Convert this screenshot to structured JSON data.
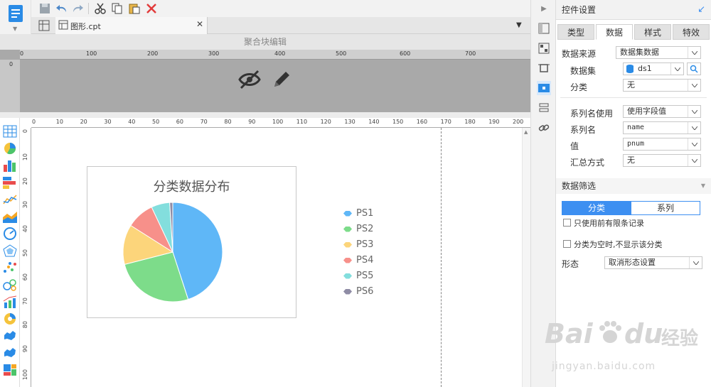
{
  "toolbar": {
    "file_tab": "图形.cpt"
  },
  "section_title": "聚合块编辑",
  "ruler": {
    "gray_top": [
      "0",
      "100",
      "200",
      "300",
      "400",
      "500",
      "600",
      "700"
    ],
    "top": [
      "0",
      "10",
      "20",
      "30",
      "40",
      "50",
      "60",
      "70",
      "80",
      "90",
      "100",
      "110",
      "120",
      "130",
      "140",
      "150",
      "160",
      "170",
      "180",
      "190",
      "200"
    ],
    "left": [
      "0",
      "10",
      "20",
      "30",
      "40",
      "50",
      "60",
      "70",
      "80",
      "90",
      "100"
    ]
  },
  "chart_data": {
    "type": "pie",
    "title": "分类数据分布",
    "categories": [
      "PS1",
      "PS2",
      "PS3",
      "PS4",
      "PS5",
      "PS6"
    ],
    "values": [
      45,
      26,
      13,
      9,
      6,
      1
    ],
    "colors": [
      "#5fb7f7",
      "#7ddc8a",
      "#fcd57b",
      "#f7908a",
      "#83dedd",
      "#8f8ca5"
    ]
  },
  "props": {
    "title": "控件设置",
    "tabs": [
      "类型",
      "数据",
      "样式",
      "特效"
    ],
    "active_tab": "数据",
    "data_source_label": "数据来源",
    "data_source_value": "数据集数据",
    "dataset_label": "数据集",
    "dataset_value": "ds1",
    "category_label": "分类",
    "category_value": "无",
    "series_use_label": "系列名使用",
    "series_use_value": "使用字段值",
    "series_name_label": "系列名",
    "series_name_value": "name",
    "value_label": "值",
    "value_value": "pnum",
    "summary_label": "汇总方式",
    "summary_value": "无",
    "filter_header": "数据筛选",
    "filter_seg": [
      "分类",
      "系列"
    ],
    "check1": "只使用前有限条记录",
    "check2": "分类为空时,不显示该分类",
    "shape_label": "形态",
    "shape_value": "取消形态设置"
  },
  "watermark": {
    "brand": "Bai",
    "brand2": "du",
    "brand_cn": "经验",
    "url": "jingyan.baidu.com"
  },
  "colors": {
    "accent": "#3d8ff1",
    "chart_bg": "#ffffff",
    "block_bg": "#a9a9a9"
  }
}
